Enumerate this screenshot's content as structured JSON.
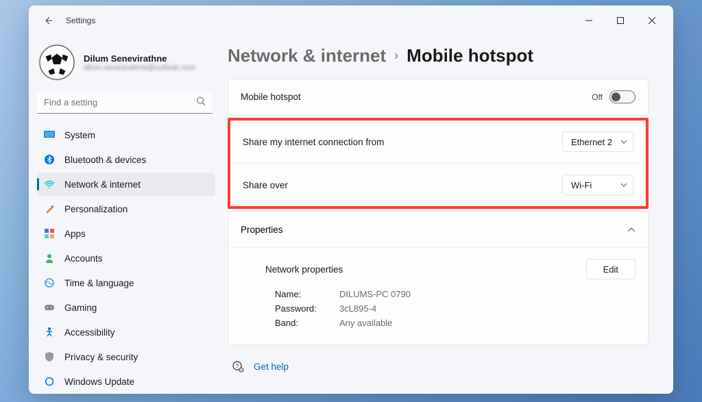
{
  "app": {
    "title": "Settings"
  },
  "user": {
    "name": "Dilum Senevirathne",
    "email": "dilum.senevirathne@outlook.com"
  },
  "search": {
    "placeholder": "Find a setting"
  },
  "nav": {
    "system": "System",
    "bluetooth": "Bluetooth & devices",
    "network": "Network & internet",
    "personalization": "Personalization",
    "apps": "Apps",
    "accounts": "Accounts",
    "time": "Time & language",
    "gaming": "Gaming",
    "accessibility": "Accessibility",
    "privacy": "Privacy & security",
    "update": "Windows Update"
  },
  "breadcrumb": {
    "parent": "Network & internet",
    "current": "Mobile hotspot"
  },
  "hotspot": {
    "label": "Mobile hotspot",
    "toggle_state": "Off",
    "share_from_label": "Share my internet connection from",
    "share_from_value": "Ethernet 2",
    "share_over_label": "Share over",
    "share_over_value": "Wi-Fi"
  },
  "properties": {
    "header": "Properties",
    "title": "Network properties",
    "edit": "Edit",
    "name_key": "Name:",
    "name_val": "DILUMS-PC 0790",
    "password_key": "Password:",
    "password_val": "3cL895-4",
    "band_key": "Band:",
    "band_val": "Any available"
  },
  "help": {
    "label": "Get help"
  }
}
